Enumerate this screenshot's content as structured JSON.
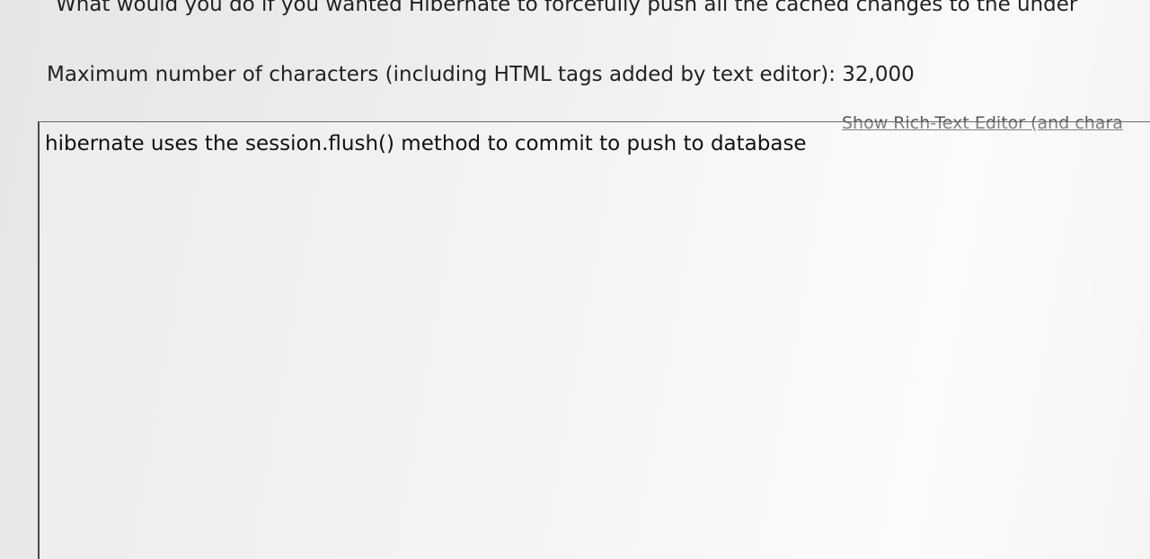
{
  "question": {
    "text": "What would you do if you wanted Hibernate to forcefully push all the cached changes to the under"
  },
  "limits": {
    "max_chars_text": "Maximum number of characters (including HTML tags added by text editor): 32,000"
  },
  "editor": {
    "rich_text_link": "Show Rich-Text Editor (and chara",
    "answer_value": "hibernate uses the session.flush() method to commit to push to database"
  }
}
